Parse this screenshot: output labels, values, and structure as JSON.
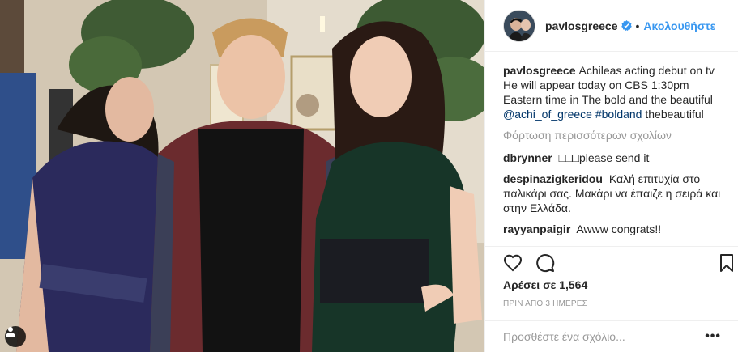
{
  "post": {
    "photo_alt": "",
    "user_tag_icon": "person-icon"
  },
  "header": {
    "username": "pavlosgreece",
    "verified_icon": "verified-badge-icon",
    "separator": "•",
    "follow_label": "Ακολουθήστε"
  },
  "caption": {
    "username": "pavlosgreece",
    "text": "Achileas acting debut on tv He will appear today on CBS 1:30pm Eastern time in The bold and the beautiful",
    "mention": "@achi_of_greece",
    "hashtag": "#boldand",
    "tail": "thebeautiful"
  },
  "load_more_label": "Φόρτωση περισσότερων σχολίων",
  "comments": [
    {
      "user": "dbrynner",
      "text": "□□□please send it"
    },
    {
      "user": "despinazigkeridou",
      "text": "Καλή επιτυχία στο παλικάρι σας. Μακάρι να έπαιζε η σειρά και στην Ελλάδα."
    },
    {
      "user": "rayyanpaigir",
      "text": "Awww congrats!!"
    }
  ],
  "actions": {
    "like_icon": "heart-icon",
    "comment_icon": "comment-icon",
    "save_icon": "bookmark-icon"
  },
  "likes_text": "Αρέσει σε 1,564",
  "timestamp": "ΠΡΙΝ ΑΠΟ 3 ΗΜΕΡΕΣ",
  "add_comment": {
    "placeholder": "Προσθέστε ένα σχόλιο...",
    "more_label": "•••"
  },
  "colors": {
    "link": "#003569",
    "follow": "#3897f0",
    "muted": "#999999",
    "text": "#262626"
  }
}
